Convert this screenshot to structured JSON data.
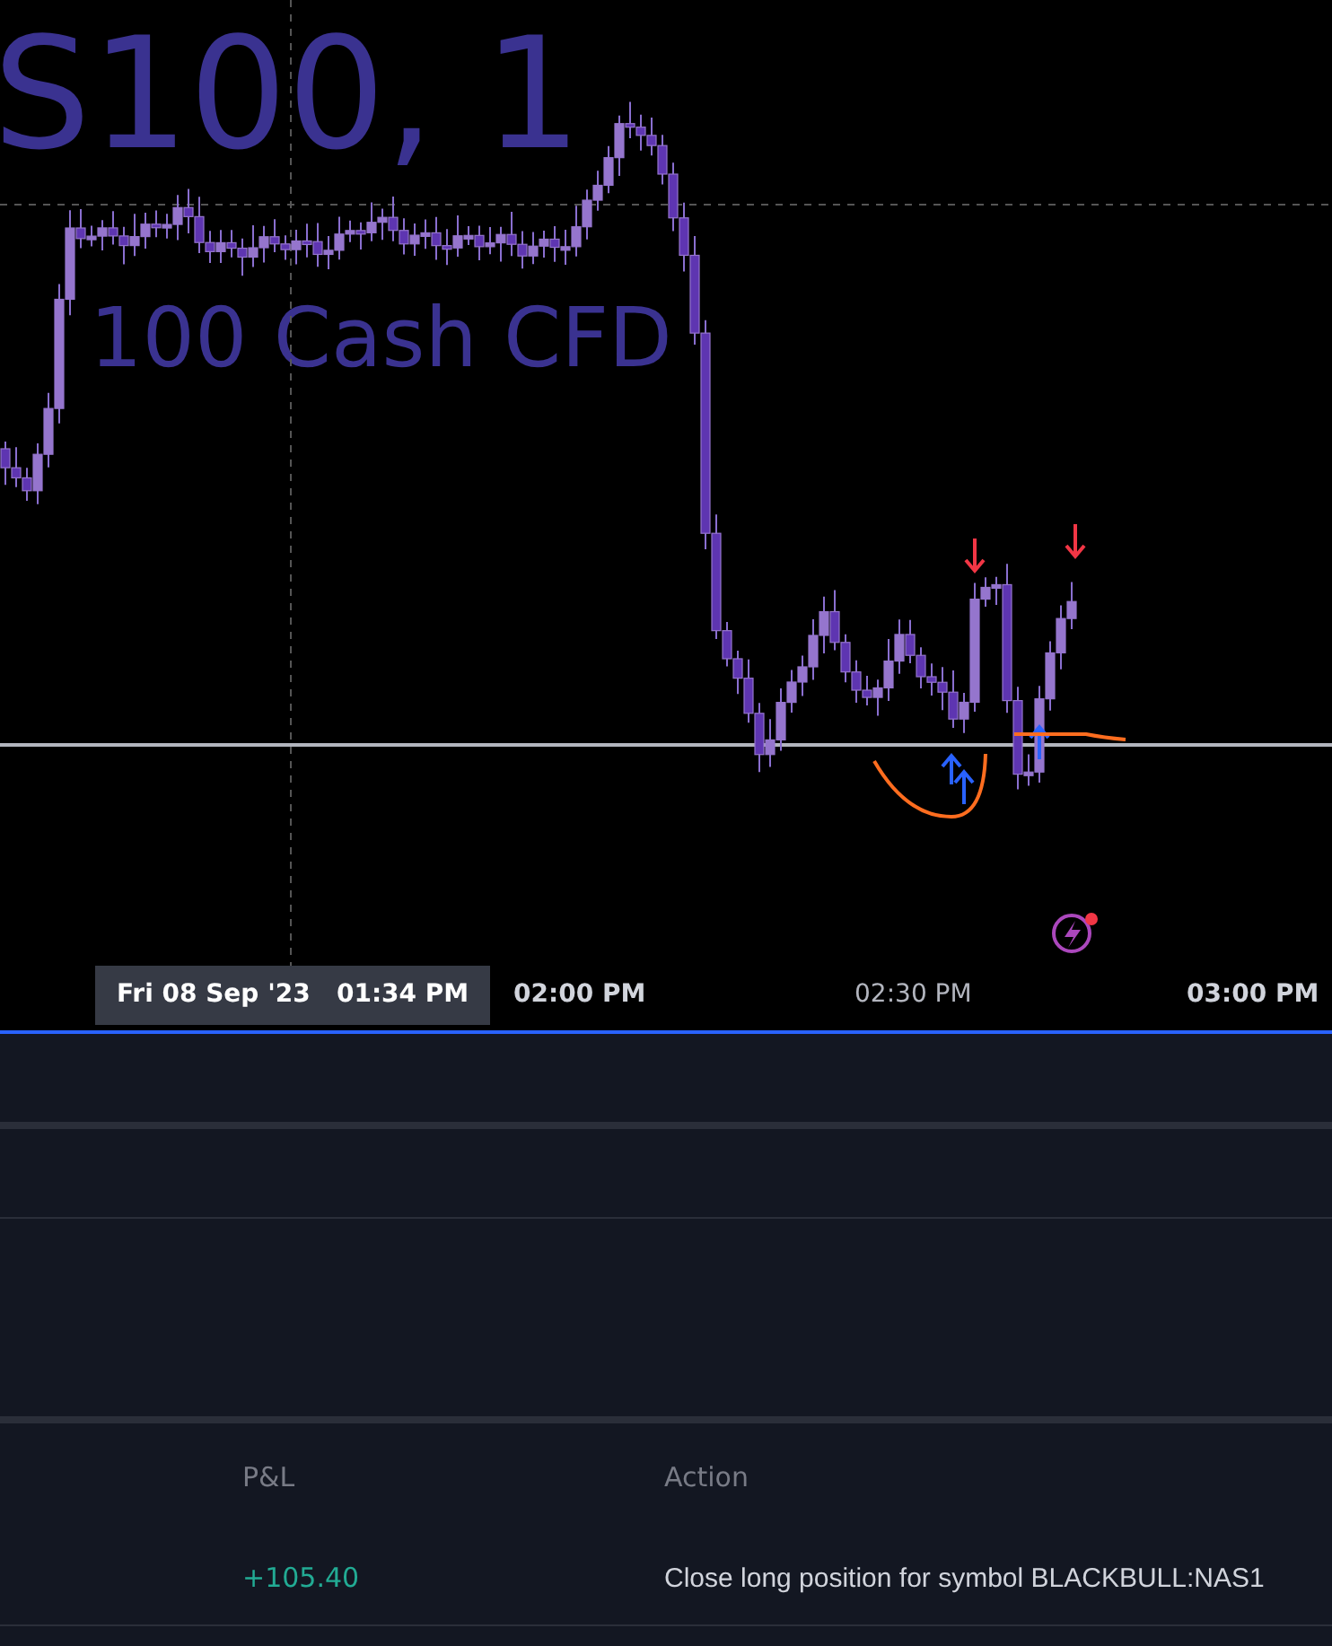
{
  "chart": {
    "watermark_symbol": "S100, 1",
    "watermark_description": "100 Cash CFD"
  },
  "time_axis": {
    "crosshair_label": "Fri 08 Sep '23   01:34 PM",
    "ticks": [
      {
        "label": "02:00 PM",
        "major": true
      },
      {
        "label": "02:30 PM",
        "major": false
      },
      {
        "label": "03:00 PM",
        "major": true
      }
    ]
  },
  "table": {
    "columns": [
      "P&L",
      "Action"
    ],
    "rows": [
      {
        "pnl": "+105.40",
        "action": "Close long position for symbol BLACKBULL:NAS1",
        "profit": true
      }
    ]
  }
}
